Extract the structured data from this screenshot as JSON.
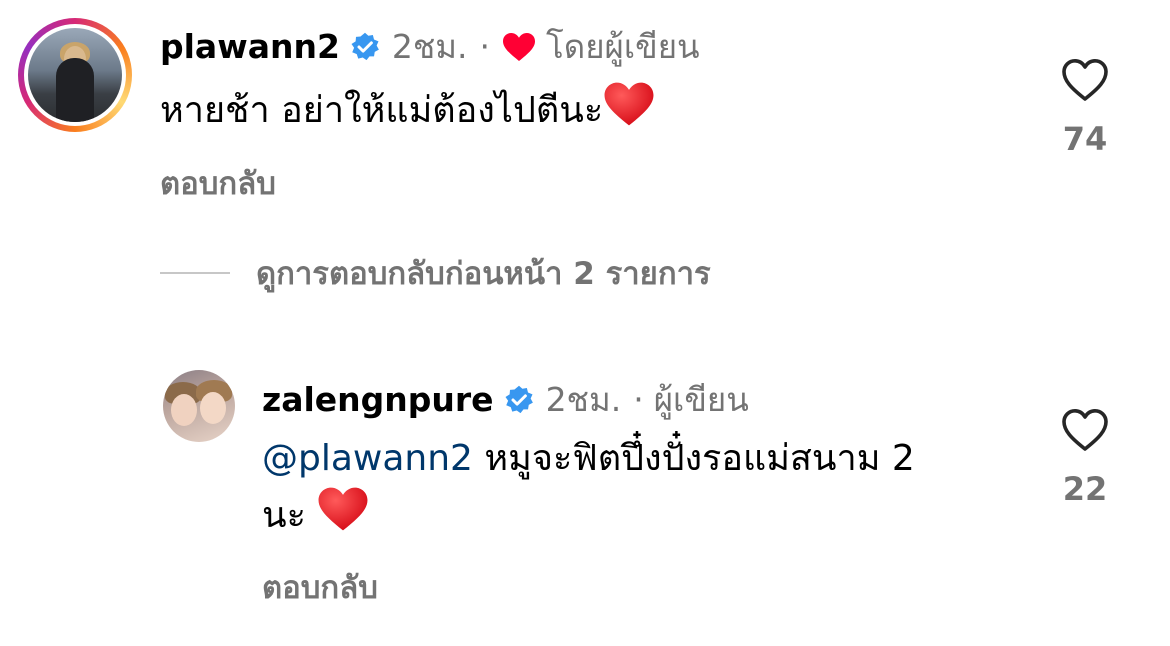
{
  "comment": {
    "username": "plawann2",
    "time": "2ชม.",
    "separator": "·",
    "liked_by_author_label": "โดยผู้เขียน",
    "text": "หายช้า อย่าให้แม่ต้องไปตีนะ",
    "reply_label": "ตอบกลับ",
    "like_count": "74",
    "verified_color": "#3897f0",
    "liked_heart_color": "#ff0034"
  },
  "view_previous_replies": "ดูการตอบกลับก่อนหน้า 2 รายการ",
  "reply": {
    "username": "zalengnpure",
    "time": "2ชม.",
    "separator": "·",
    "author_label": "ผู้เขียน",
    "mention": "@plawann2",
    "text_line1": " หมูจะฟิตปึ๋งปั๋งรอแม่สนาม 2",
    "text_line2": "นะ ",
    "reply_label": "ตอบกลับ",
    "like_count": "22"
  }
}
